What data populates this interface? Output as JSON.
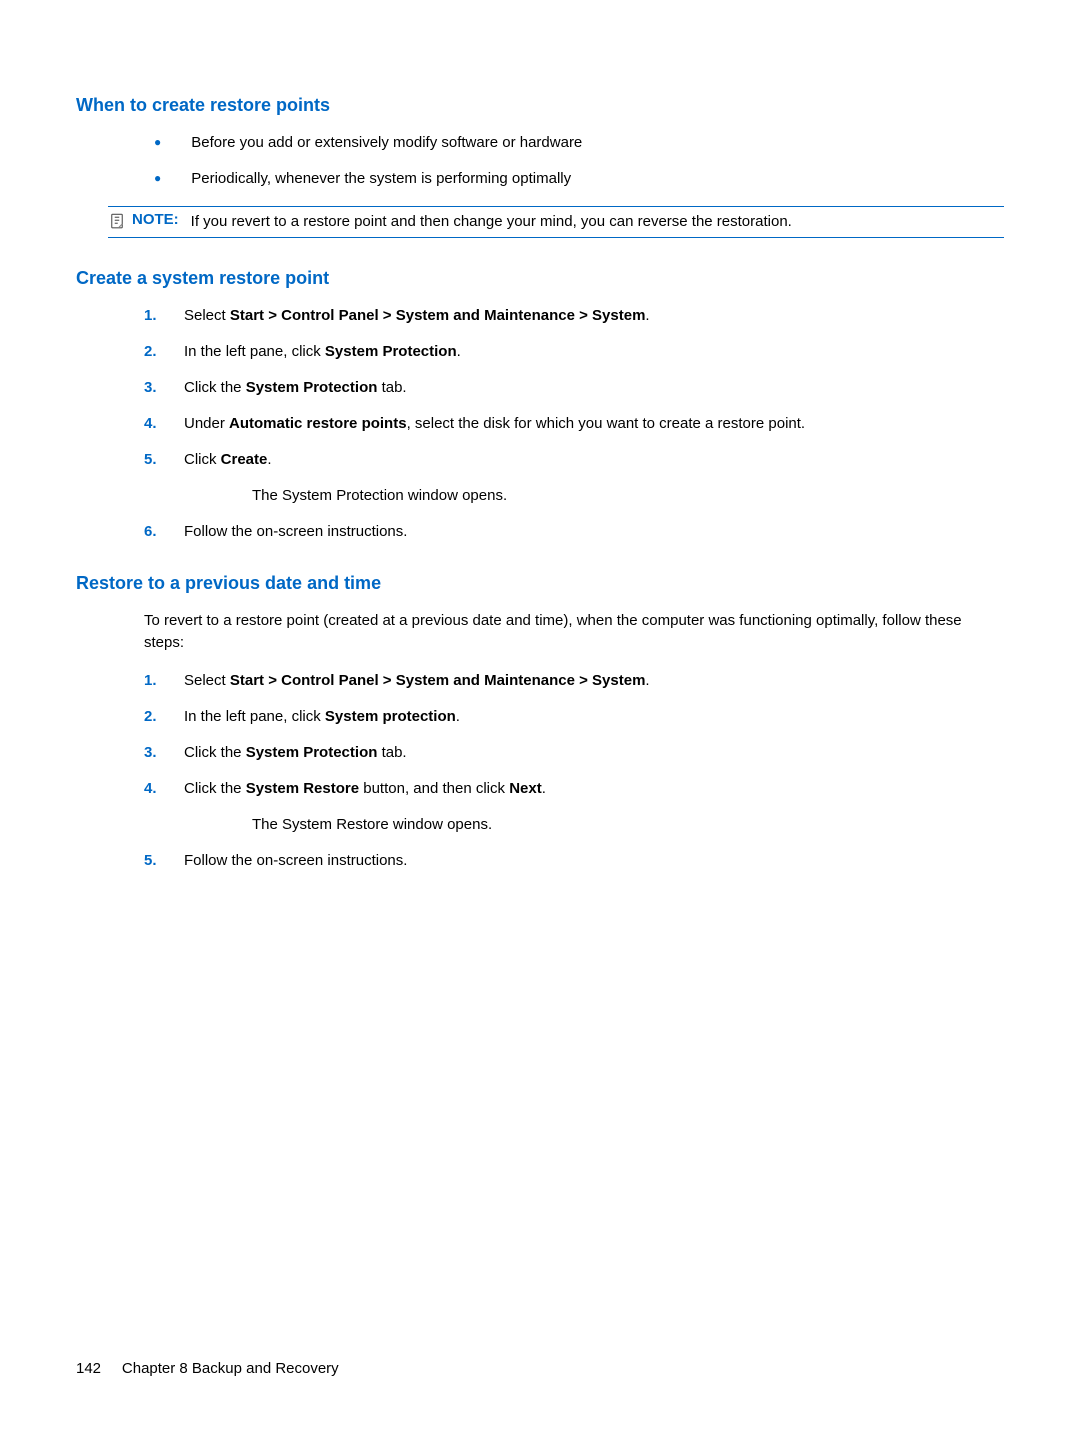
{
  "section1": {
    "heading": "When to create restore points",
    "bullets": [
      "Before you add or extensively modify software or hardware",
      "Periodically, whenever the system is performing optimally"
    ],
    "note": {
      "label": "NOTE:",
      "text": "If you revert to a restore point and then change your mind, you can reverse the restoration."
    }
  },
  "section2": {
    "heading": "Create a system restore point",
    "steps": [
      {
        "num": "1.",
        "parts": [
          {
            "t": "Select "
          },
          {
            "t": "Start > Control Panel > System and Maintenance > System",
            "b": true
          },
          {
            "t": "."
          }
        ]
      },
      {
        "num": "2.",
        "parts": [
          {
            "t": "In the left pane, click "
          },
          {
            "t": "System Protection",
            "b": true
          },
          {
            "t": "."
          }
        ]
      },
      {
        "num": "3.",
        "parts": [
          {
            "t": "Click the "
          },
          {
            "t": "System Protection",
            "b": true
          },
          {
            "t": " tab."
          }
        ]
      },
      {
        "num": "4.",
        "parts": [
          {
            "t": "Under "
          },
          {
            "t": "Automatic restore points",
            "b": true
          },
          {
            "t": ", select the disk for which you want to create a restore point."
          }
        ]
      },
      {
        "num": "5.",
        "parts": [
          {
            "t": "Click "
          },
          {
            "t": "Create",
            "b": true
          },
          {
            "t": "."
          }
        ],
        "after": "The System Protection window opens."
      },
      {
        "num": "6.",
        "parts": [
          {
            "t": "Follow the on-screen instructions."
          }
        ]
      }
    ]
  },
  "section3": {
    "heading": "Restore to a previous date and time",
    "intro": "To revert to a restore point (created at a previous date and time), when the computer was functioning optimally, follow these steps:",
    "steps": [
      {
        "num": "1.",
        "parts": [
          {
            "t": "Select "
          },
          {
            "t": "Start > Control Panel > System and Maintenance > System",
            "b": true
          },
          {
            "t": "."
          }
        ]
      },
      {
        "num": "2.",
        "parts": [
          {
            "t": "In the left pane, click "
          },
          {
            "t": "System protection",
            "b": true
          },
          {
            "t": "."
          }
        ]
      },
      {
        "num": "3.",
        "parts": [
          {
            "t": "Click the "
          },
          {
            "t": "System Protection",
            "b": true
          },
          {
            "t": " tab."
          }
        ]
      },
      {
        "num": "4.",
        "parts": [
          {
            "t": "Click the "
          },
          {
            "t": "System Restore",
            "b": true
          },
          {
            "t": " button, and then click "
          },
          {
            "t": "Next",
            "b": true
          },
          {
            "t": "."
          }
        ],
        "after": "The System Restore window opens."
      },
      {
        "num": "5.",
        "parts": [
          {
            "t": "Follow the on-screen instructions."
          }
        ]
      }
    ]
  },
  "footer": {
    "page": "142",
    "chapter": "Chapter 8   Backup and Recovery"
  }
}
